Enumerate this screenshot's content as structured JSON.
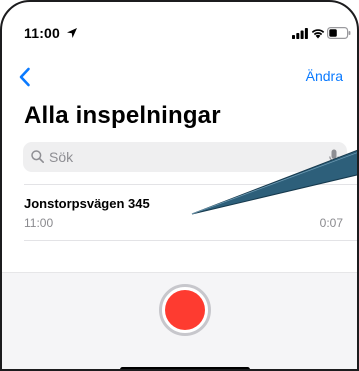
{
  "status_bar": {
    "time": "11:00",
    "icons": [
      "location-arrow-icon",
      "cellular-signal-icon",
      "wifi-icon",
      "battery-icon"
    ]
  },
  "nav": {
    "back_icon": "chevron-left-icon",
    "edit_label": "Ändra"
  },
  "page": {
    "title": "Alla inspelningar"
  },
  "search": {
    "placeholder": "Sök",
    "value": "",
    "icons": [
      "search-icon",
      "microphone-icon"
    ]
  },
  "recordings": [
    {
      "title": "Jonstorpsvägen 345",
      "time": "11:00",
      "duration": "0:07"
    }
  ],
  "record_panel": {
    "button_icon": "record-icon"
  },
  "colors": {
    "accent": "#0a7aff",
    "record": "#fe3b30",
    "annotation_arrow": "#2d5f7a"
  }
}
